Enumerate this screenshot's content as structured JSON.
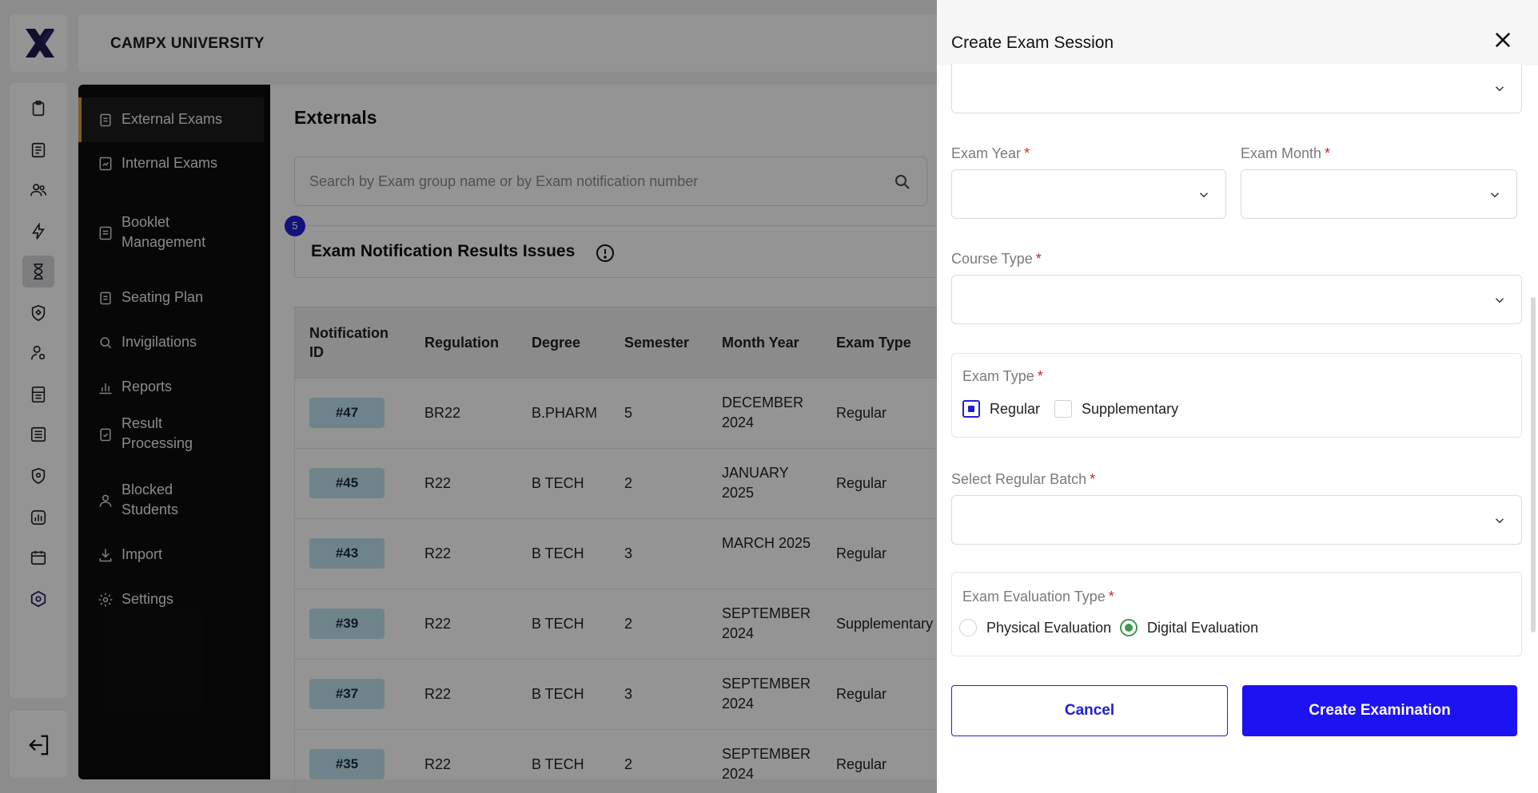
{
  "app": {
    "brand": "CAMPX UNIVERSITY"
  },
  "rail": {
    "icons": [
      "clipboard-icon",
      "document-icon",
      "users-icon",
      "bolt-icon",
      "hourglass-icon",
      "shield-badge-icon",
      "user-gear-icon",
      "calculator-icon",
      "list-icon",
      "shield-pin-icon",
      "chart-icon",
      "calendar-icon",
      "hexagon-icon"
    ],
    "active_icon": "hourglass-icon",
    "bottom_icon": "logout-icon"
  },
  "subnav": {
    "items": [
      {
        "label": "External Exams",
        "active": true
      },
      {
        "label": "Internal Exams"
      },
      {
        "label": "Booklet Management"
      },
      {
        "label": "Seating Plan"
      },
      {
        "label": "Invigilations"
      },
      {
        "label": "Reports"
      },
      {
        "label": "Result Processing"
      },
      {
        "label": "Blocked Students"
      },
      {
        "label": "Import"
      },
      {
        "label": "Settings"
      }
    ]
  },
  "main": {
    "title": "Externals",
    "search_placeholder": "Search by Exam group name or by Exam notification number",
    "issues_title": "Exam Notification Results Issues",
    "issues_count": "5",
    "table": {
      "headers": [
        "Notification ID",
        "Regulation",
        "Degree",
        "Semester",
        "Month Year",
        "Exam Type"
      ],
      "rows": [
        {
          "id": "#47",
          "regulation": "BR22",
          "degree": "B.PHARM",
          "semester": "5",
          "month_year": "DECEMBER 2024",
          "exam_type": "Regular"
        },
        {
          "id": "#45",
          "regulation": "R22",
          "degree": "B TECH",
          "semester": "2",
          "month_year": "JANUARY 2025",
          "exam_type": "Regular"
        },
        {
          "id": "#43",
          "regulation": "R22",
          "degree": "B TECH",
          "semester": "3",
          "month_year": "MARCH 2025",
          "exam_type": "Regular"
        },
        {
          "id": "#39",
          "regulation": "R22",
          "degree": "B TECH",
          "semester": "2",
          "month_year": "SEPTEMBER 2024",
          "exam_type": "Supplementary"
        },
        {
          "id": "#37",
          "regulation": "R22",
          "degree": "B TECH",
          "semester": "3",
          "month_year": "SEPTEMBER 2024",
          "exam_type": "Regular"
        },
        {
          "id": "#35",
          "regulation": "R22",
          "degree": "B TECH",
          "semester": "2",
          "month_year": "SEPTEMBER 2024",
          "exam_type": "Regular"
        }
      ]
    }
  },
  "drawer": {
    "title": "Create Exam Session",
    "top_select_value": "",
    "exam_year": {
      "label": "Exam Year",
      "required": "*",
      "value": ""
    },
    "exam_month": {
      "label": "Exam Month",
      "required": "*",
      "value": ""
    },
    "course_type": {
      "label": "Course Type",
      "required": "*",
      "value": ""
    },
    "exam_type": {
      "label": "Exam Type",
      "required": "*",
      "options": [
        {
          "label": "Regular",
          "checked": true
        },
        {
          "label": "Supplementary",
          "checked": false
        }
      ]
    },
    "regular_batch": {
      "label": "Select Regular Batch",
      "required": "*",
      "value": ""
    },
    "evaluation_type": {
      "label": "Exam Evaluation Type",
      "required": "*",
      "options": [
        {
          "label": "Physical Evaluation",
          "selected": false
        },
        {
          "label": "Digital Evaluation",
          "selected": true
        }
      ]
    },
    "cancel_label": "Cancel",
    "create_label": "Create Examination"
  },
  "colors": {
    "accent": "#1d12f2",
    "active_nav_bar": "#e2a13a",
    "pill": "#bfe3ee",
    "radio_selected": "#3c9a4c",
    "required": "#d61f1f"
  }
}
